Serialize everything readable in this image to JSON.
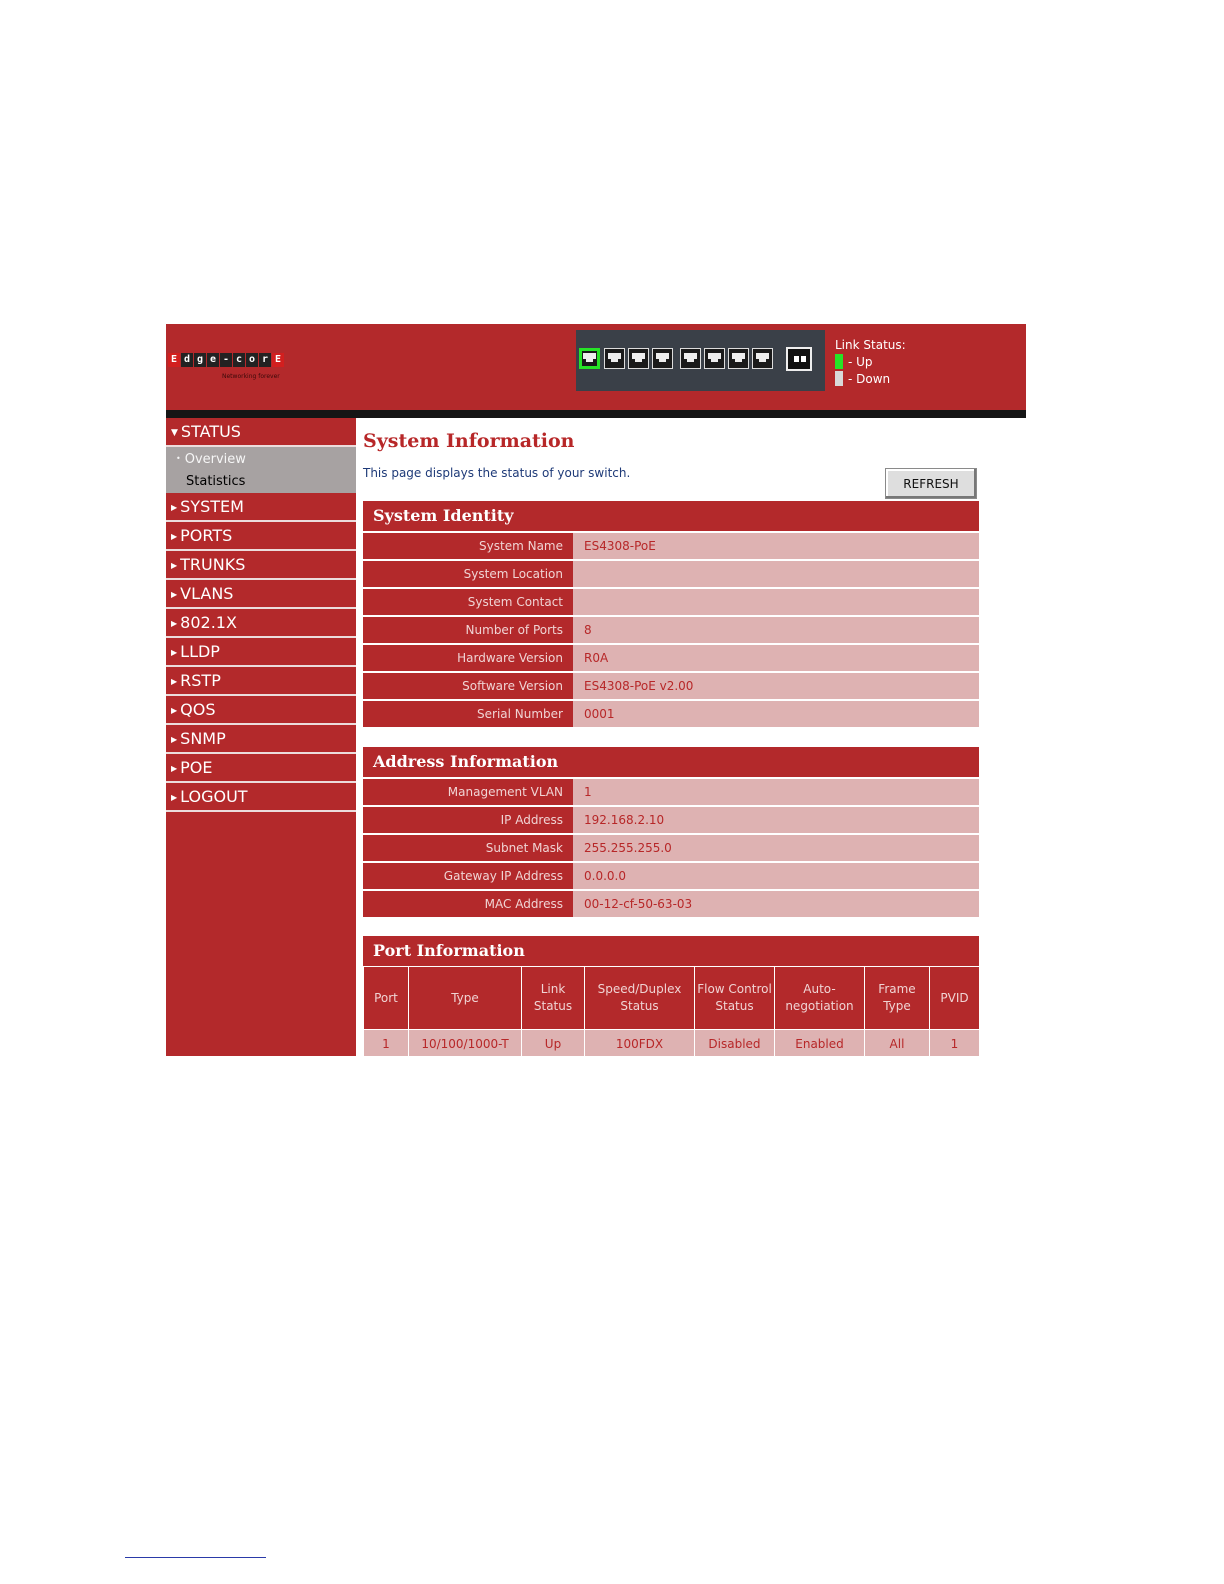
{
  "header": {
    "logo_letters": [
      "E",
      "d",
      "g",
      "e",
      "-",
      "c",
      "o",
      "r",
      "E"
    ],
    "logo_tagline": "Networking forever",
    "ports": [
      {
        "number": 1,
        "status": "up"
      },
      {
        "number": 2,
        "status": "down"
      },
      {
        "number": 3,
        "status": "down"
      },
      {
        "number": 4,
        "status": "down"
      },
      {
        "number": 5,
        "status": "down"
      },
      {
        "number": 6,
        "status": "down"
      },
      {
        "number": 7,
        "status": "down"
      },
      {
        "number": 8,
        "status": "down"
      }
    ],
    "link_status": {
      "title": "Link Status:",
      "up_label": "- Up",
      "down_label": "- Down",
      "up_color": "#26e326",
      "down_color": "#d9d9d9"
    }
  },
  "sidebar": {
    "status": {
      "label": "STATUS",
      "children": [
        {
          "label": "Overview",
          "active": true
        },
        {
          "label": "Statistics",
          "active": false
        }
      ]
    },
    "items": [
      {
        "label": "SYSTEM"
      },
      {
        "label": "PORTS"
      },
      {
        "label": "TRUNKS"
      },
      {
        "label": "VLANS"
      },
      {
        "label": "802.1X"
      },
      {
        "label": "LLDP"
      },
      {
        "label": "RSTP"
      },
      {
        "label": "QOS"
      },
      {
        "label": "SNMP"
      },
      {
        "label": "POE"
      },
      {
        "label": "LOGOUT"
      }
    ]
  },
  "main": {
    "title": "System Information",
    "description": "This page displays the status of your switch.",
    "refresh_label": "REFRESH",
    "system_identity": {
      "title": "System Identity",
      "rows": [
        {
          "label": "System Name",
          "value": "ES4308-PoE"
        },
        {
          "label": "System Location",
          "value": ""
        },
        {
          "label": "System Contact",
          "value": ""
        },
        {
          "label": "Number of Ports",
          "value": "8"
        },
        {
          "label": "Hardware Version",
          "value": "R0A"
        },
        {
          "label": "Software Version",
          "value": "ES4308-PoE v2.00"
        },
        {
          "label": "Serial Number",
          "value": "0001"
        }
      ]
    },
    "address_info": {
      "title": "Address Information",
      "rows": [
        {
          "label": "Management VLAN",
          "value": "1"
        },
        {
          "label": "IP Address",
          "value": "192.168.2.10"
        },
        {
          "label": "Subnet Mask",
          "value": "255.255.255.0"
        },
        {
          "label": "Gateway IP Address",
          "value": "0.0.0.0"
        },
        {
          "label": "MAC Address",
          "value": "00-12-cf-50-63-03"
        }
      ]
    },
    "port_info": {
      "title": "Port Information",
      "headers": [
        "Port",
        "Type",
        "Link Status",
        "Speed/Duplex Status",
        "Flow Control Status",
        "Auto-negotiation",
        "Frame Type",
        "PVID"
      ],
      "rows": [
        [
          "1",
          "10/100/1000-T",
          "Up",
          "100FDX",
          "Disabled",
          "Enabled",
          "All",
          "1"
        ]
      ]
    }
  }
}
